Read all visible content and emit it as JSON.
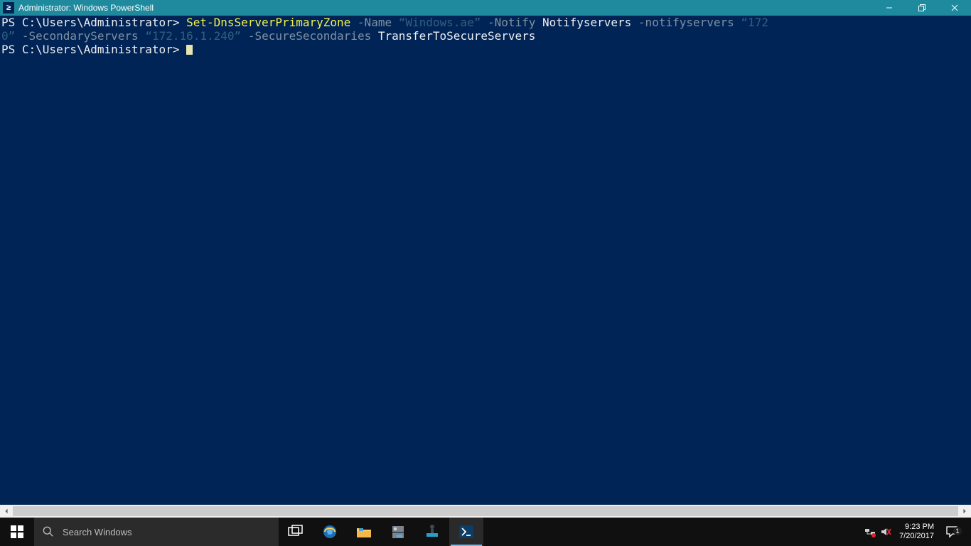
{
  "window": {
    "title": "Administrator: Windows PowerShell"
  },
  "terminal": {
    "line1": {
      "prompt": "PS C:\\Users\\Administrator>",
      "cmdlet": "Set-DnsServerPrimaryZone",
      "p_name": "-Name",
      "v_name": "“Windows.ae”",
      "p_notify": "-Notify",
      "v_notify": "Notifyservers",
      "p_notifyservers": "-notifyservers",
      "v_notifyservers_a": "“172"
    },
    "line2": {
      "v_notifyservers_b": "0”",
      "p_secondary": "-SecondaryServers",
      "v_secondary": "“172.16.1.240”",
      "p_secure": "-SecureSecondaries",
      "v_secure": "TransferToSecureServers"
    },
    "line3": {
      "prompt": "PS C:\\Users\\Administrator>"
    }
  },
  "taskbar": {
    "search_placeholder": "Search Windows",
    "clock_time": "9:23 PM",
    "clock_date": "7/20/2017",
    "badge": "1"
  }
}
